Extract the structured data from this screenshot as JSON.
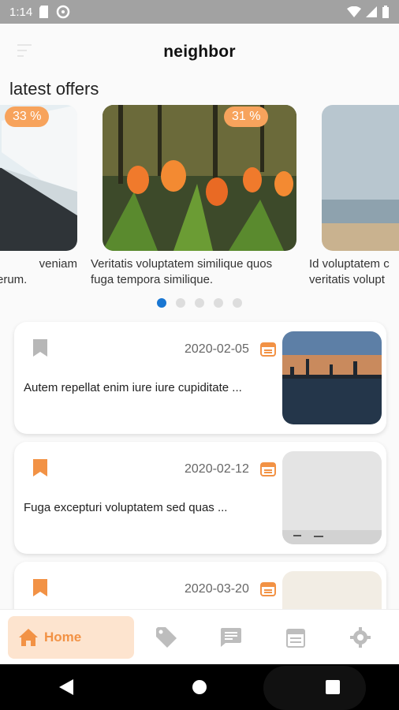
{
  "status_bar": {
    "time": "1:14"
  },
  "app_bar": {
    "title": "neighbor"
  },
  "section": {
    "title": "latest offers"
  },
  "offers": [
    {
      "caption_line1": "veniam",
      "caption_line2": "erum.",
      "discount": "33 %"
    },
    {
      "caption_line1": "Veritatis voluptatem similique quos",
      "caption_line2": "fuga tempora similique.",
      "discount": "31 %"
    },
    {
      "caption_line1": "Id voluptatem c",
      "caption_line2": "veritatis volupt",
      "discount": ""
    }
  ],
  "carousel": {
    "active_index": 0,
    "count": 5
  },
  "posts": [
    {
      "date": "2020-02-05",
      "text": "Autem repellat enim iure iure cupiditate ...",
      "bookmarked": false
    },
    {
      "date": "2020-02-12",
      "text": "Fuga excepturi voluptatem sed quas ...",
      "bookmarked": true
    },
    {
      "date": "2020-03-20",
      "text": "",
      "bookmarked": true
    }
  ],
  "bottom_nav": {
    "home_label": "Home",
    "items": [
      "tag-icon",
      "chat-icon",
      "calendar-icon",
      "gear-icon"
    ]
  },
  "colors": {
    "accent": "#f29245",
    "badge": "#f7a35c",
    "active_dot": "#1976d2",
    "home_bg": "#fde4cf"
  }
}
